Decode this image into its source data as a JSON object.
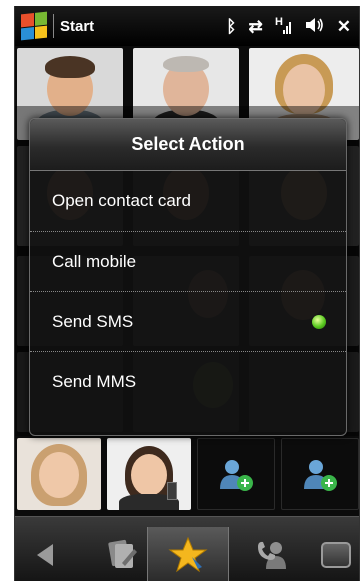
{
  "statusbar": {
    "title": "Start",
    "icons": [
      "bluetooth-icon",
      "data-transfer-icon",
      "hsdpa-signal-icon",
      "speaker-icon",
      "close-icon"
    ],
    "glyph_bluetooth": "ᛒ",
    "glyph_transfer": "⇄",
    "glyph_signal": "H",
    "glyph_speaker": "◀(",
    "glyph_close": "✕"
  },
  "dialog": {
    "title": "Select Action",
    "actions": [
      {
        "label": "Open contact card"
      },
      {
        "label": "Call mobile"
      },
      {
        "label": "Send SMS",
        "indicator": "green-dot"
      },
      {
        "label": "Send MMS"
      }
    ]
  },
  "bottombar": {
    "tabs": [
      "back-icon",
      "history-icon",
      "favorites-star-icon",
      "calls-icon",
      "menu-icon"
    ],
    "selected": "favorites"
  },
  "colors": {
    "indicator_green": "#58c91f",
    "star_yellow": "#f4b71e",
    "add_badge_green": "#3ab54a"
  }
}
